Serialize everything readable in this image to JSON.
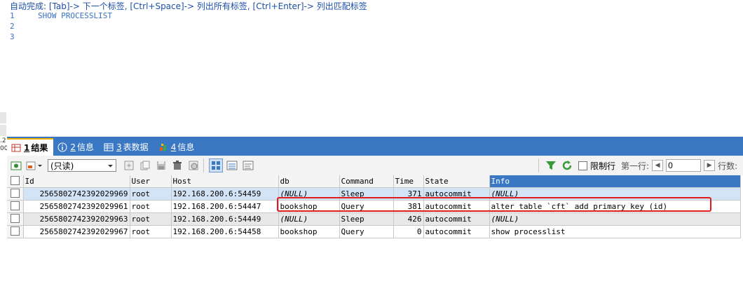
{
  "editor": {
    "hint": "自动完成: [Tab]-> 下一个标签, [Ctrl+Space]-> 列出所有标签, [Ctrl+Enter]-> 列出匹配标签",
    "lines": [
      {
        "num": "1",
        "code": "SHOW PROCESSLIST"
      },
      {
        "num": "2",
        "code": ""
      },
      {
        "num": "3",
        "code": ""
      }
    ],
    "left_frag_1": ".2",
    "left_frag_2": "00"
  },
  "tabs": [
    {
      "icon": "result-grid-icon",
      "num": "1",
      "label": "结果"
    },
    {
      "icon": "info-icon",
      "num": "2",
      "label": "信息"
    },
    {
      "icon": "table-data-icon",
      "num": "3",
      "label": "表数据"
    },
    {
      "icon": "info-chart-icon",
      "num": "4",
      "label": "信息"
    }
  ],
  "toolbar": {
    "mode_select": "(只读)",
    "limit_label": "限制行",
    "first_row_label": "第一行:",
    "first_row_value": "0",
    "rows_label": "行数:"
  },
  "grid": {
    "columns": [
      "Id",
      "User",
      "Host",
      "db",
      "Command",
      "Time",
      "State",
      "Info"
    ],
    "rows": [
      {
        "id": "2565802742392029969",
        "user": "root",
        "host": "192.168.200.6:54459",
        "db": "(NULL)",
        "db_null": true,
        "command": "Sleep",
        "time": "371",
        "state": "autocommit",
        "info": "(NULL)",
        "info_null": true
      },
      {
        "id": "2565802742392029961",
        "user": "root",
        "host": "192.168.200.6:54447",
        "db": "bookshop",
        "db_null": false,
        "command": "Query",
        "time": "381",
        "state": "autocommit",
        "info": "alter table `cft` add primary key (id)",
        "info_null": false
      },
      {
        "id": "2565802742392029963",
        "user": "root",
        "host": "192.168.200.6:54449",
        "db": "(NULL)",
        "db_null": true,
        "command": "Sleep",
        "time": "426",
        "state": "autocommit",
        "info": "(NULL)",
        "info_null": true
      },
      {
        "id": "2565802742392029967",
        "user": "root",
        "host": "192.168.200.6:54458",
        "db": "bookshop",
        "db_null": false,
        "command": "Query",
        "time": "0",
        "state": "autocommit",
        "info": "show processlist",
        "info_null": false
      }
    ]
  },
  "colors": {
    "accent": "#3b78c4",
    "highlight_box": "#e01c1c",
    "selected_row": "#d4e4f7"
  }
}
